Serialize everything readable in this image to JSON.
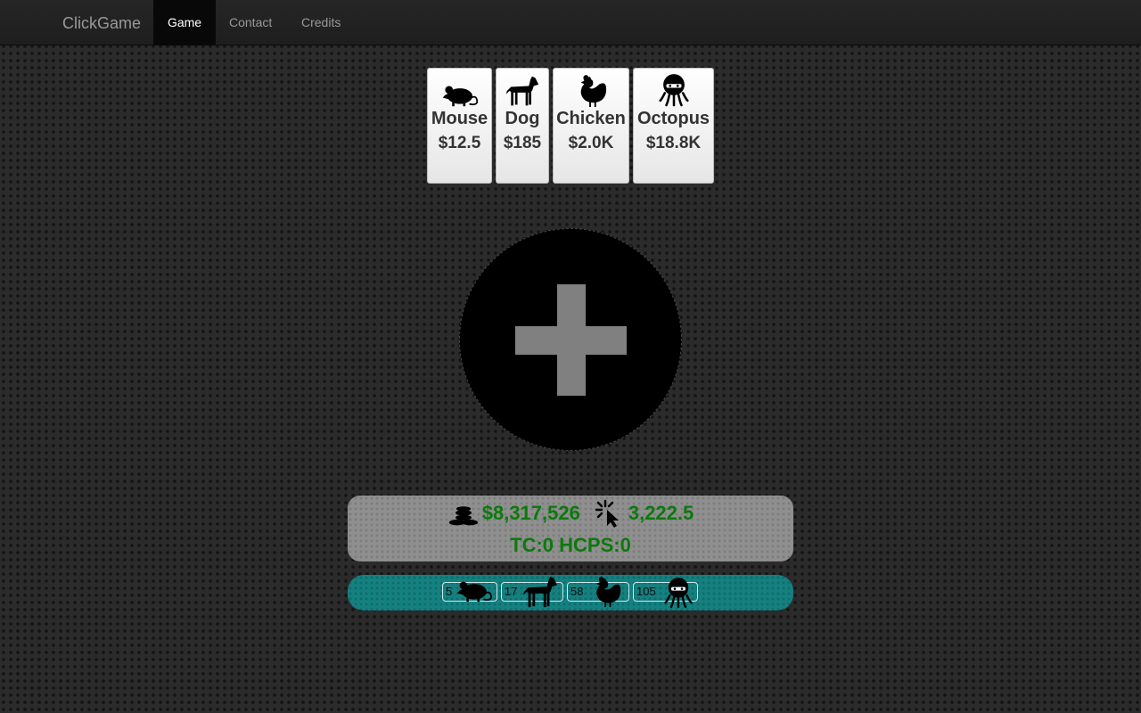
{
  "navbar": {
    "brand": "ClickGame",
    "links": [
      {
        "label": "Game",
        "active": true
      },
      {
        "label": "Contact",
        "active": false
      },
      {
        "label": "Credits",
        "active": false
      }
    ]
  },
  "shop": {
    "items": [
      {
        "name": "Mouse",
        "price": "$12.5",
        "icon": "mouse-icon"
      },
      {
        "name": "Dog",
        "price": "$185",
        "icon": "dog-icon"
      },
      {
        "name": "Chicken",
        "price": "$2.0K",
        "icon": "chicken-icon"
      },
      {
        "name": "Octopus",
        "price": "$18.8K",
        "icon": "octopus-icon"
      }
    ]
  },
  "click_button": {
    "icon": "plus-icon"
  },
  "stats": {
    "money": "$8,317,526",
    "per_click": "3,222.5",
    "tc_hcps": "TC:0 HCPS:0"
  },
  "owned": {
    "items": [
      {
        "count": "5",
        "icon": "mouse-icon"
      },
      {
        "count": "17",
        "icon": "dog-icon"
      },
      {
        "count": "58",
        "icon": "chicken-icon"
      },
      {
        "count": "105",
        "icon": "octopus-icon"
      }
    ]
  },
  "colors": {
    "accent_green": "#0b7a0b",
    "teal_bar": "#158080",
    "navbar_bg": "#222222"
  }
}
